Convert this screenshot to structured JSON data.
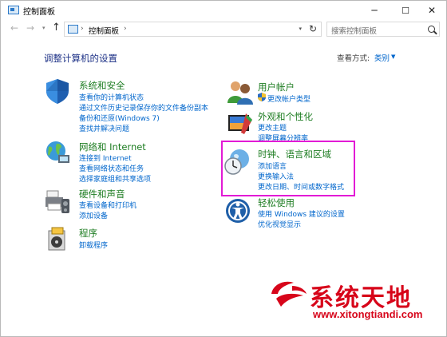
{
  "window": {
    "title": "控制面板",
    "minimize": "─",
    "maximize": "☐",
    "close": "✕"
  },
  "nav": {
    "back": "←",
    "forward": "→",
    "dropdown": "▾",
    "up": "↑",
    "chevron": "›",
    "breadcrumb": "控制面板",
    "refresh": "↻",
    "search_placeholder": "搜索控制面板"
  },
  "main": {
    "title": "调整计算机的设置",
    "view_by_label": "查看方式:",
    "view_by_value": "类别",
    "view_by_caret": "▼"
  },
  "categories": [
    {
      "id": "system",
      "title": "系统和安全",
      "links": [
        "查看你的计算机状态",
        "通过文件历史记录保存你的文件备份副本",
        "备份和还原(Windows 7)",
        "查找并解决问题"
      ]
    },
    {
      "id": "network",
      "title": "网络和 Internet",
      "links": [
        "连接到 Internet",
        "查看网络状态和任务",
        "选择家庭组和共享选项"
      ]
    },
    {
      "id": "hardware",
      "title": "硬件和声音",
      "links": [
        "查看设备和打印机",
        "添加设备"
      ]
    },
    {
      "id": "programs",
      "title": "程序",
      "links": [
        "卸载程序"
      ]
    },
    {
      "id": "accounts",
      "title": "用户帐户",
      "links": [
        "更改帐户类型"
      ]
    },
    {
      "id": "appearance",
      "title": "外观和个性化",
      "links": [
        "更改主题",
        "调整屏幕分辨率"
      ]
    },
    {
      "id": "clock",
      "title": "时钟、语言和区域",
      "links": [
        "添加语言",
        "更换输入法",
        "更改日期、时间或数字格式"
      ]
    },
    {
      "id": "ease",
      "title": "轻松使用",
      "links": [
        "使用 Windows 建议的设置",
        "优化视觉显示"
      ]
    }
  ],
  "watermark": {
    "name": "系统天地",
    "url": "www.xitongtiandi.com"
  },
  "colors": {
    "category_title": "#1e7d22",
    "link": "#0066cc",
    "main_title": "#1e3287",
    "highlight_border": "#e21ad5",
    "watermark": "#d7051a"
  }
}
